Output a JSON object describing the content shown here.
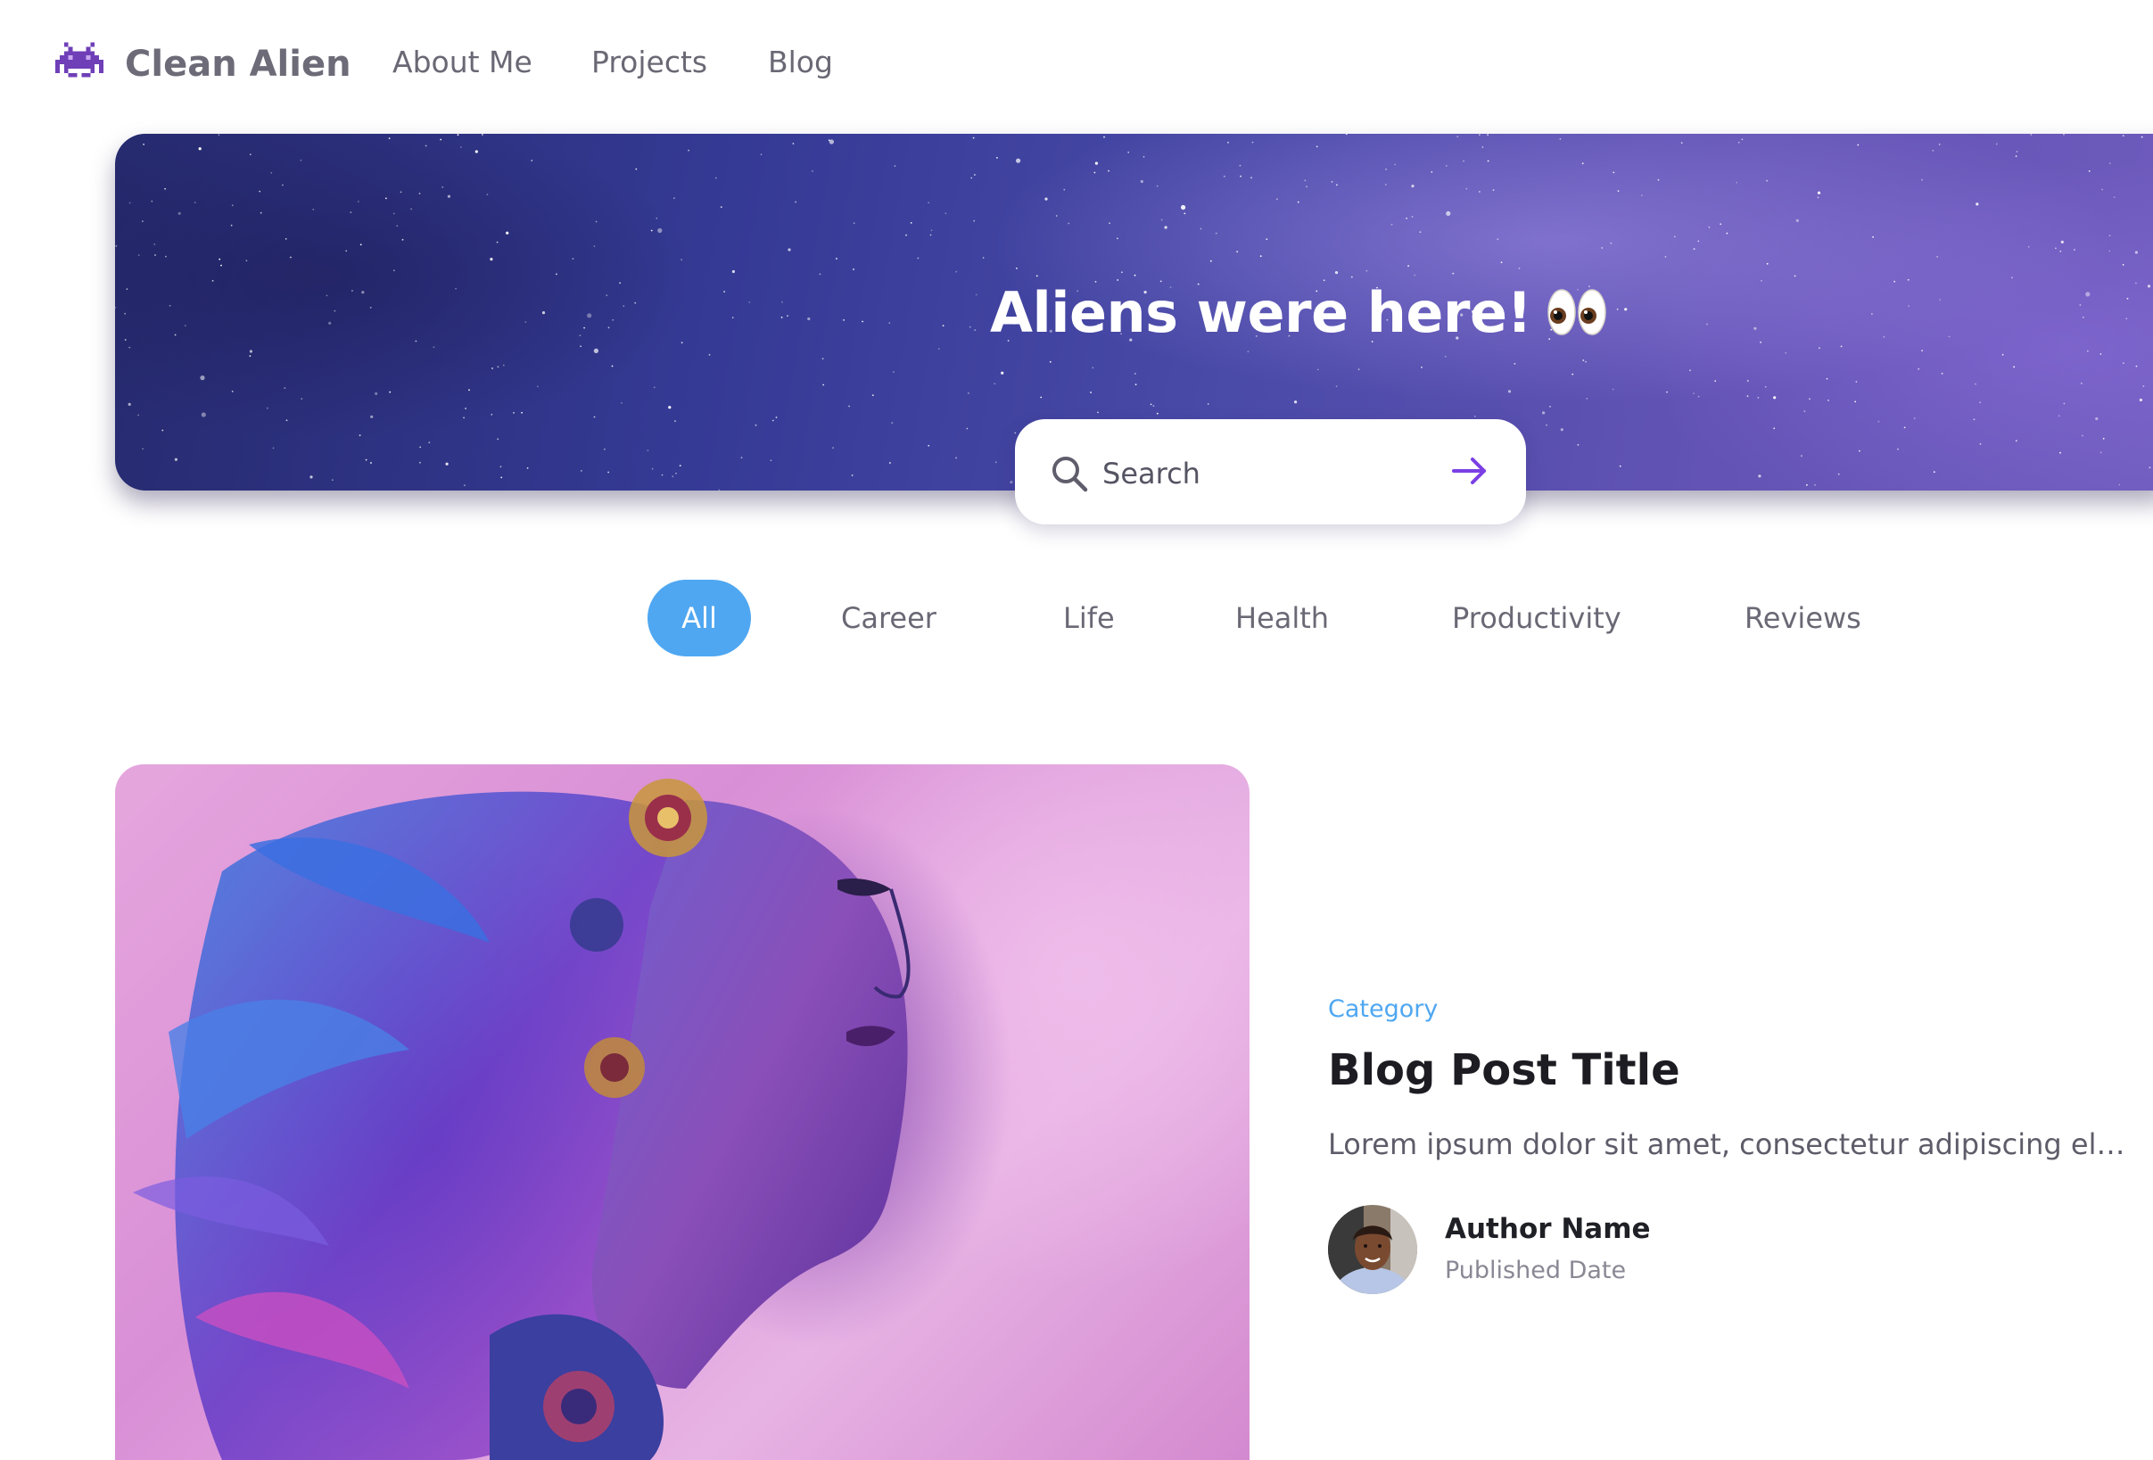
{
  "site": {
    "name": "Clean Alien",
    "logo_icon": "purple-space-invader-icon"
  },
  "nav": {
    "items": [
      {
        "label": "About Me"
      },
      {
        "label": "Projects"
      },
      {
        "label": "Blog"
      }
    ]
  },
  "hero": {
    "title": "Aliens were here!",
    "emoji_icon": "eyes-icon"
  },
  "search": {
    "placeholder": "Search",
    "value": "",
    "submit_icon": "arrow-right-icon"
  },
  "filters": {
    "active": "All",
    "items": [
      {
        "label": "All"
      },
      {
        "label": "Career"
      },
      {
        "label": "Life"
      },
      {
        "label": "Health"
      },
      {
        "label": "Productivity"
      },
      {
        "label": "Reviews"
      }
    ]
  },
  "featured_post": {
    "category": "Category",
    "title": "Blog Post Title",
    "excerpt": "Lorem ipsum dolor sit amet, consectetur adipiscing elit...",
    "author": {
      "name": "Author Name",
      "published": "Published Date"
    }
  },
  "colors": {
    "accent": "#4fa7f1",
    "nav_text": "#6b6875",
    "arrow": "#7b3fe4",
    "logo_purple": "#6f3fb8"
  }
}
